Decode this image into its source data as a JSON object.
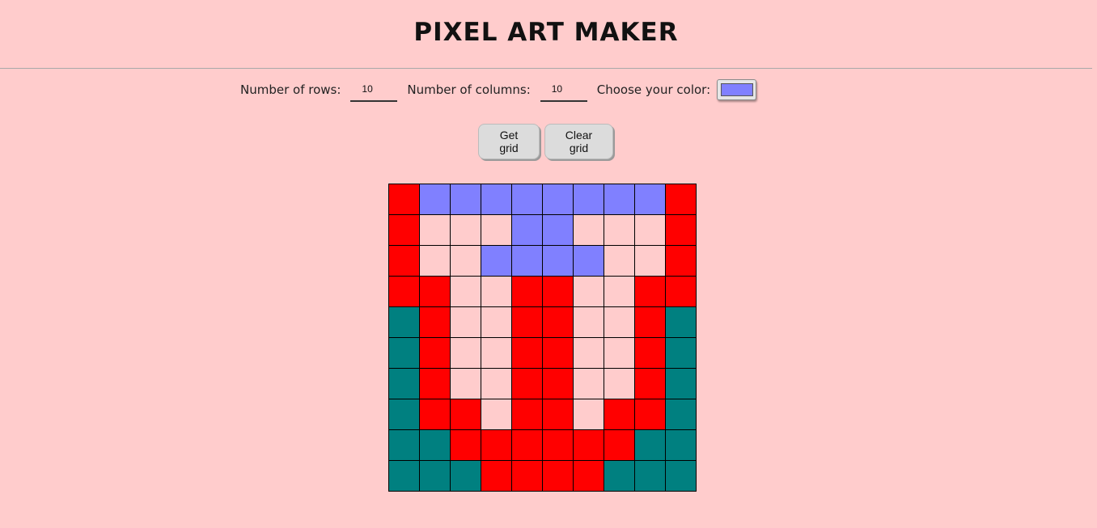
{
  "header": {
    "title": "PIXEL ART MAKER"
  },
  "controls": {
    "rows_label": "Number of rows:",
    "rows_value": "10",
    "columns_label": "Number of columns:",
    "columns_value": "10",
    "color_label": "Choose your color:",
    "selected_color": "#8080ff"
  },
  "buttons": {
    "get_grid": "Get grid",
    "clear_grid": "Clear grid"
  },
  "palette": {
    "R": "#ff0000",
    "B": "#8080ff",
    "P": "#ffcccc",
    "T": "#008080"
  },
  "grid": [
    [
      "R",
      "B",
      "B",
      "B",
      "B",
      "B",
      "B",
      "B",
      "B",
      "R"
    ],
    [
      "R",
      "P",
      "P",
      "P",
      "B",
      "B",
      "P",
      "P",
      "P",
      "R"
    ],
    [
      "R",
      "P",
      "P",
      "B",
      "B",
      "B",
      "B",
      "P",
      "P",
      "R"
    ],
    [
      "R",
      "R",
      "P",
      "P",
      "R",
      "R",
      "P",
      "P",
      "R",
      "R"
    ],
    [
      "T",
      "R",
      "P",
      "P",
      "R",
      "R",
      "P",
      "P",
      "R",
      "T"
    ],
    [
      "T",
      "R",
      "P",
      "P",
      "R",
      "R",
      "P",
      "P",
      "R",
      "T"
    ],
    [
      "T",
      "R",
      "P",
      "P",
      "R",
      "R",
      "P",
      "P",
      "R",
      "T"
    ],
    [
      "T",
      "R",
      "R",
      "P",
      "R",
      "R",
      "P",
      "R",
      "R",
      "T"
    ],
    [
      "T",
      "T",
      "R",
      "R",
      "R",
      "R",
      "R",
      "R",
      "T",
      "T"
    ],
    [
      "T",
      "T",
      "T",
      "R",
      "R",
      "R",
      "R",
      "T",
      "T",
      "T"
    ]
  ]
}
